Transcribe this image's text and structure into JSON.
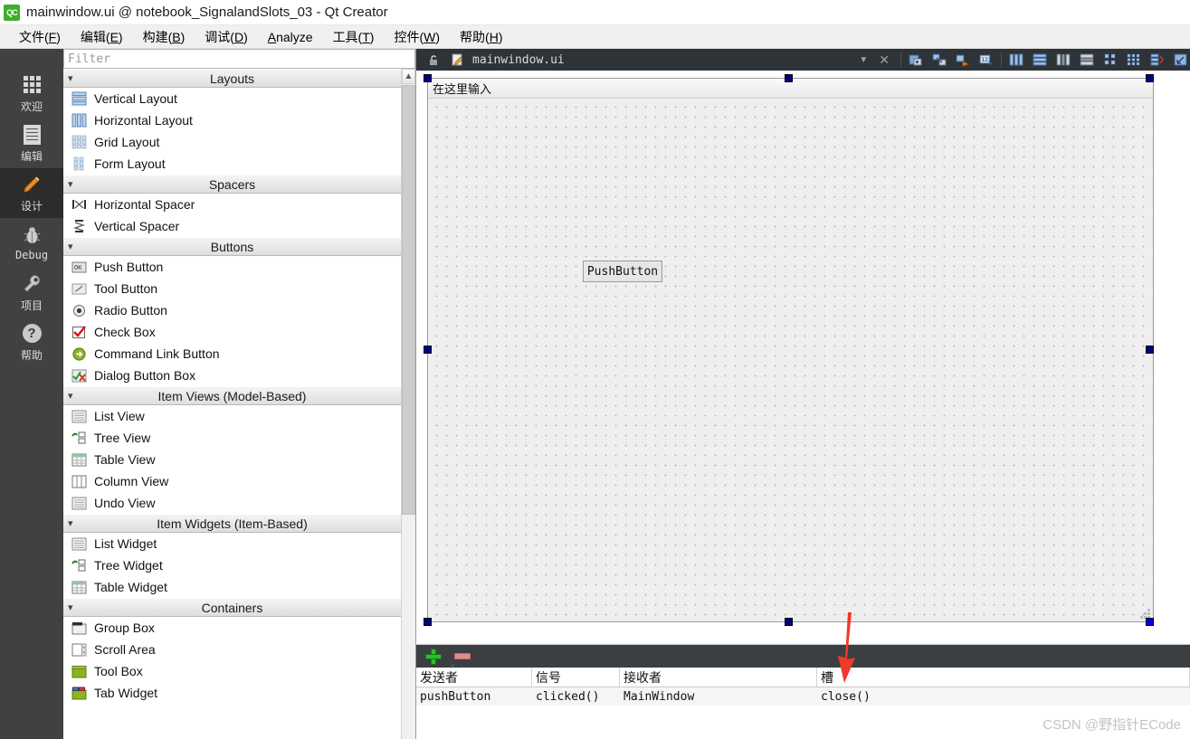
{
  "window": {
    "title": "mainwindow.ui @ notebook_SignalandSlots_03 - Qt Creator",
    "logo_text": "QC"
  },
  "menubar": {
    "items": [
      {
        "label": "文件",
        "mnemonic": "F"
      },
      {
        "label": "编辑",
        "mnemonic": "E"
      },
      {
        "label": "构建",
        "mnemonic": "B"
      },
      {
        "label": "调试",
        "mnemonic": "D"
      },
      {
        "label": "Analyze",
        "mnemonic": "A"
      },
      {
        "label": "工具",
        "mnemonic": "T"
      },
      {
        "label": "控件",
        "mnemonic": "W"
      },
      {
        "label": "帮助",
        "mnemonic": "H"
      }
    ]
  },
  "modebar": {
    "items": [
      {
        "label": "欢迎",
        "icon": "grid-icon",
        "active": false
      },
      {
        "label": "编辑",
        "icon": "document-icon",
        "active": false
      },
      {
        "label": "设计",
        "icon": "pencil-icon",
        "active": true
      },
      {
        "label": "Debug",
        "icon": "bug-icon",
        "active": false
      },
      {
        "label": "项目",
        "icon": "wrench-icon",
        "active": false
      },
      {
        "label": "帮助",
        "icon": "question-mark-icon",
        "active": false
      }
    ]
  },
  "editor_tab": {
    "file_name": "mainwindow.ui",
    "lock_icon": "unlocked-padlock-icon",
    "file_icon": "ui-file-icon",
    "dropdown_icon": "chevron-down-icon",
    "close_icon": "close-icon",
    "toolbar_icons": [
      "edit-widgets-icon",
      "edit-signals-slots-icon",
      "edit-buddies-icon",
      "edit-tab-order-icon",
      "layout-horizontally-icon",
      "layout-vertically-icon",
      "layout-splitter-horizontal-icon",
      "layout-splitter-vertical-icon",
      "layout-grid-icon",
      "layout-form-icon",
      "break-layout-icon",
      "adjust-size-icon"
    ]
  },
  "widget_box": {
    "filter_placeholder": "Filter",
    "scroll_up_icon": "chevron-up-icon",
    "sections": [
      {
        "title": "Layouts",
        "items": [
          {
            "label": "Vertical Layout",
            "icon": "vertical-layout-icon"
          },
          {
            "label": "Horizontal Layout",
            "icon": "horizontal-layout-icon"
          },
          {
            "label": "Grid Layout",
            "icon": "grid-layout-icon"
          },
          {
            "label": "Form Layout",
            "icon": "form-layout-icon"
          }
        ]
      },
      {
        "title": "Spacers",
        "items": [
          {
            "label": "Horizontal Spacer",
            "icon": "horizontal-spacer-icon"
          },
          {
            "label": "Vertical Spacer",
            "icon": "vertical-spacer-icon"
          }
        ]
      },
      {
        "title": "Buttons",
        "items": [
          {
            "label": "Push Button",
            "icon": "push-button-icon"
          },
          {
            "label": "Tool Button",
            "icon": "tool-button-icon"
          },
          {
            "label": "Radio Button",
            "icon": "radio-button-icon"
          },
          {
            "label": "Check Box",
            "icon": "check-box-icon"
          },
          {
            "label": "Command Link Button",
            "icon": "command-link-button-icon"
          },
          {
            "label": "Dialog Button Box",
            "icon": "dialog-button-box-icon"
          }
        ]
      },
      {
        "title": "Item Views (Model-Based)",
        "items": [
          {
            "label": "List View",
            "icon": "list-view-icon"
          },
          {
            "label": "Tree View",
            "icon": "tree-view-icon"
          },
          {
            "label": "Table View",
            "icon": "table-view-icon"
          },
          {
            "label": "Column View",
            "icon": "column-view-icon"
          },
          {
            "label": "Undo View",
            "icon": "undo-view-icon"
          }
        ]
      },
      {
        "title": "Item Widgets (Item-Based)",
        "items": [
          {
            "label": "List Widget",
            "icon": "list-widget-icon"
          },
          {
            "label": "Tree Widget",
            "icon": "tree-widget-icon"
          },
          {
            "label": "Table Widget",
            "icon": "table-widget-icon"
          }
        ]
      },
      {
        "title": "Containers",
        "items": [
          {
            "label": "Group Box",
            "icon": "group-box-icon"
          },
          {
            "label": "Scroll Area",
            "icon": "scroll-area-icon"
          },
          {
            "label": "Tool Box",
            "icon": "tool-box-icon"
          },
          {
            "label": "Tab Widget",
            "icon": "tab-widget-icon"
          }
        ]
      }
    ]
  },
  "form": {
    "menubar_placeholder": "在这里输入",
    "push_button_label": "PushButton"
  },
  "signal_slot_editor": {
    "add_button_icon": "plus-icon",
    "remove_button_icon": "minus-icon",
    "columns": [
      "发送者",
      "信号",
      "接收者",
      "槽"
    ],
    "sort_indicator": "^",
    "rows": [
      {
        "sender": "pushButton",
        "signal": "clicked()",
        "receiver": "MainWindow",
        "slot": "close()"
      }
    ]
  },
  "annotation": {
    "arrow": "red-down-arrow",
    "target": "add-connection-button"
  },
  "watermark": {
    "text": "CSDN @野指针ECode"
  }
}
